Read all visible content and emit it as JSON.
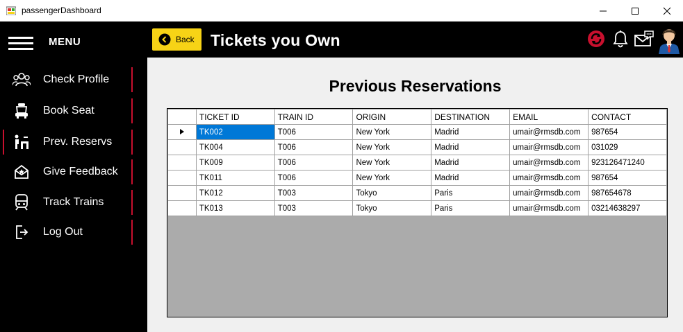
{
  "window": {
    "title": "passengerDashboard"
  },
  "header": {
    "menu_label": "MENU",
    "back_label": "Back",
    "page_title": "Tickets you Own"
  },
  "sidebar": {
    "items": [
      {
        "label": "Check Profile",
        "icon": "users-icon"
      },
      {
        "label": "Book Seat",
        "icon": "seat-icon"
      },
      {
        "label": "Prev. Reservs",
        "icon": "reservation-icon"
      },
      {
        "label": "Give Feedback",
        "icon": "feedback-icon"
      },
      {
        "label": "Track Trains",
        "icon": "train-icon"
      },
      {
        "label": "Log Out",
        "icon": "logout-icon"
      }
    ]
  },
  "main": {
    "section_title": "Previous Reservations",
    "table": {
      "columns": [
        "TICKET ID",
        "TRAIN ID",
        "ORIGIN",
        "DESTINATION",
        "EMAIL",
        "CONTACT"
      ],
      "rows": [
        [
          "TK002",
          "T006",
          "New York",
          "Madrid",
          "umair@rmsdb.com",
          "987654"
        ],
        [
          "TK004",
          "T006",
          "New York",
          "Madrid",
          "umair@rmsdb.com",
          "031029"
        ],
        [
          "TK009",
          "T006",
          "New York",
          "Madrid",
          "umair@rmsdb.com",
          "923126471240"
        ],
        [
          "TK011",
          "T006",
          "New York",
          "Madrid",
          "umair@rmsdb.com",
          "987654"
        ],
        [
          "TK012",
          "T003",
          "Tokyo",
          "Paris",
          "umair@rmsdb.com",
          "987654678"
        ],
        [
          "TK013",
          "T003",
          "Tokyo",
          "Paris",
          "umair@rmsdb.com",
          "03214638297"
        ]
      ]
    }
  },
  "colors": {
    "accent_yellow": "#f7d316",
    "sidebar_bg": "#000000",
    "divider_red": "#c8102e",
    "selection_blue": "#0078d7"
  }
}
